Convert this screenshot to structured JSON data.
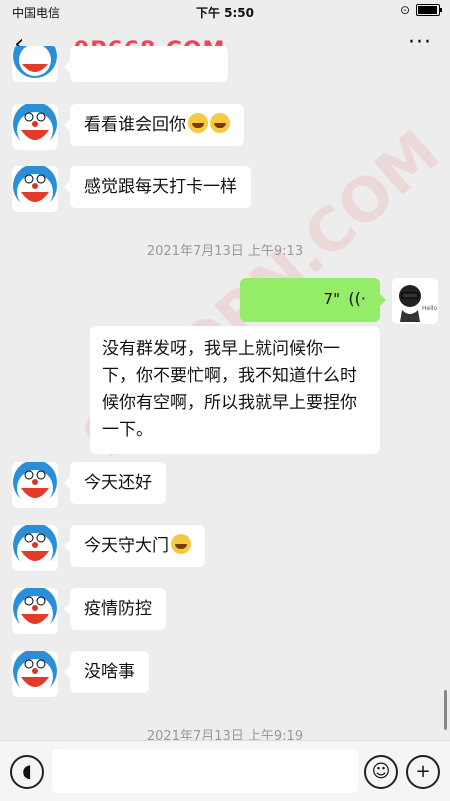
{
  "status": {
    "carrier": "中国电信",
    "time": "下午 5:50"
  },
  "nav": {
    "back": "‹",
    "title": "",
    "more": "···"
  },
  "watermark": "9P668.COM",
  "watermark_big": "91PORN.COM",
  "messages": {
    "m1": "看看谁会回你",
    "m2": "感觉跟每天打卡一样",
    "ts1": "2021年7月13日 上午9:13",
    "voice_duration": "7\"",
    "voice_icon": "voice-wave-icon",
    "transcript": "没有群发呀，我早上就问候你一下，你不要忙啊，我不知道什么时候你有空啊，所以我就早上要捏你一下。",
    "m3": "今天还好",
    "m4": "今天守大门",
    "m5": "疫情防控",
    "m6": "没啥事",
    "ts2": "2021年7月13日 上午9:19"
  },
  "input": {
    "value": "",
    "placeholder": ""
  },
  "colors": {
    "self_bubble": "#95ec69",
    "background": "#ededed"
  }
}
